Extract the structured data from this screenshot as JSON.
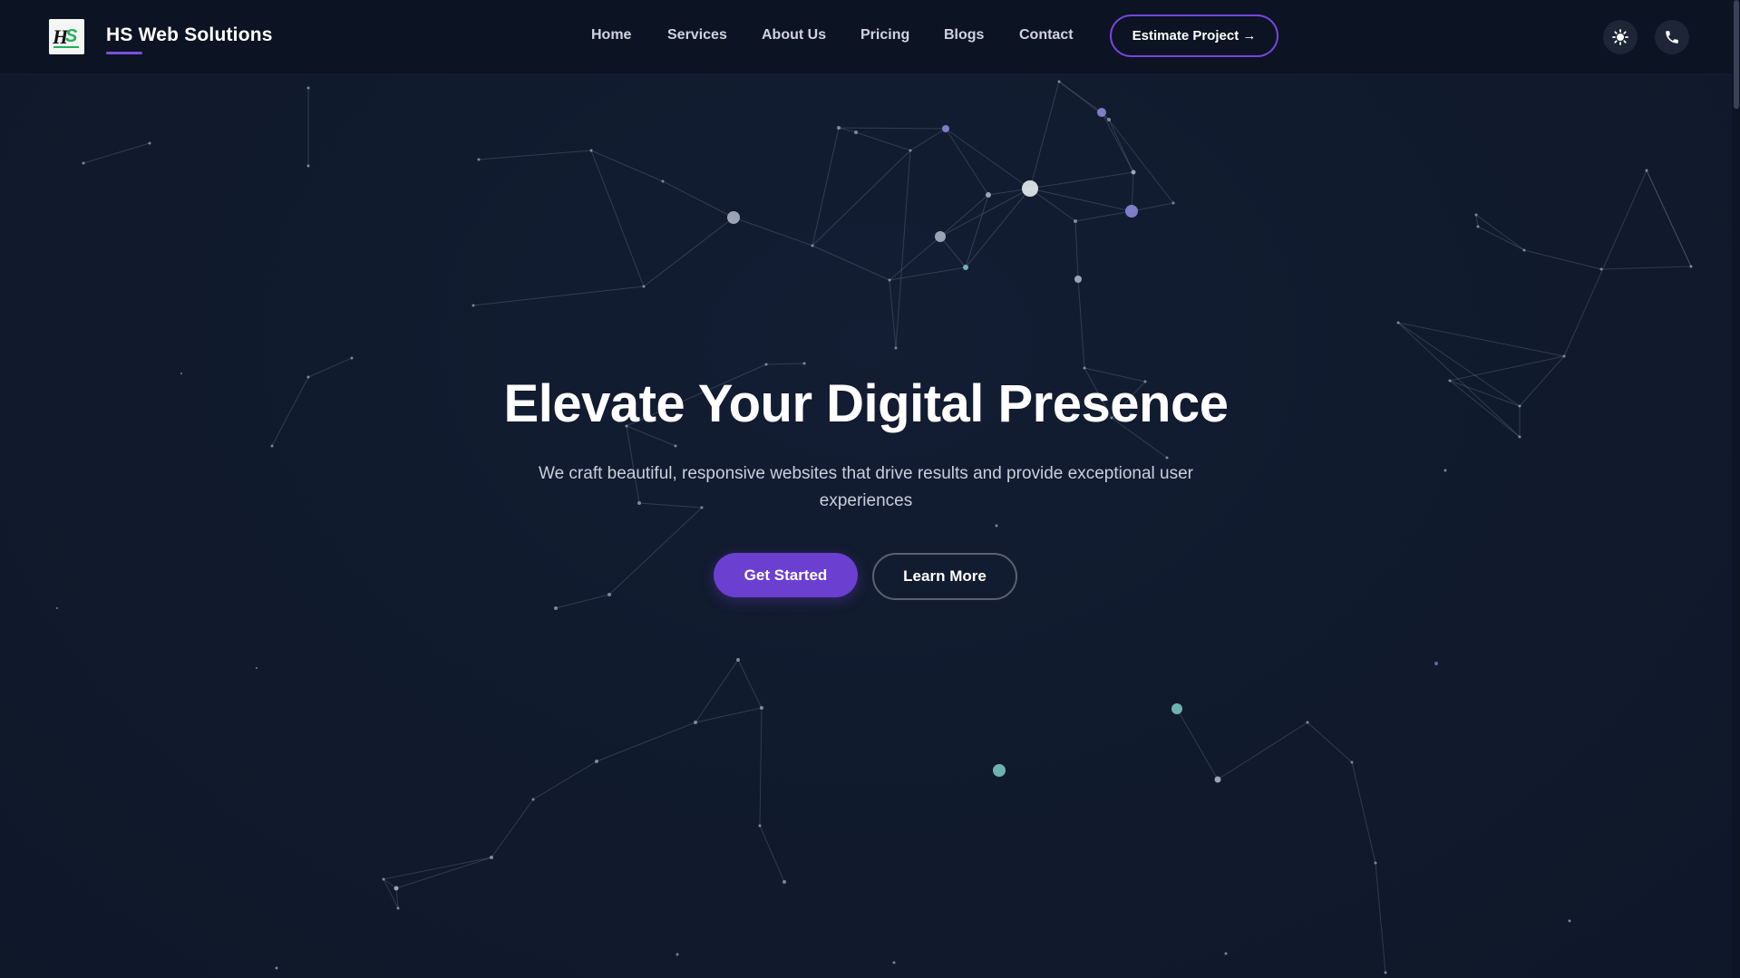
{
  "navbar": {
    "brand": "HS Web Solutions",
    "logo_text": "HS",
    "links": [
      {
        "label": "Home"
      },
      {
        "label": "Services"
      },
      {
        "label": "About Us"
      },
      {
        "label": "Pricing"
      },
      {
        "label": "Blogs"
      },
      {
        "label": "Contact"
      }
    ],
    "cta_label": "Estimate Project →",
    "icons": [
      "sun-icon",
      "phone-icon"
    ]
  },
  "hero": {
    "title": "Elevate Your Digital Presence",
    "subtitle": "We craft beautiful, responsive websites that drive results and provide exceptional user experiences",
    "primary_label": "Get Started",
    "secondary_label": "Learn More"
  },
  "colors": {
    "background": "#111a2d",
    "navbar": "#0c1322",
    "accent": "#6b3fd0",
    "accent_border": "#7446e0",
    "particle": "#aab2c5",
    "particle_purple": "#8b86d8",
    "particle_teal": "#79c2c2"
  }
}
